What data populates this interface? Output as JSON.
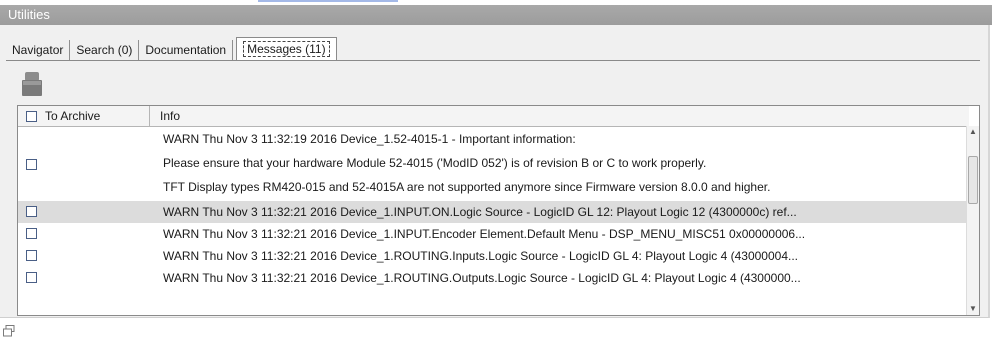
{
  "panel": {
    "title": "Utilities"
  },
  "tabs": [
    {
      "label": "Navigator"
    },
    {
      "label": "Search (0)"
    },
    {
      "label": "Documentation"
    },
    {
      "label": "Messages (11)"
    }
  ],
  "toolbar": {
    "archive_icon": "archive-icon"
  },
  "grid": {
    "columns": [
      "To Archive",
      "Info"
    ],
    "rows": [
      {
        "lines": [
          "WARN  Thu Nov  3 11:32:19 2016 Device_1.52-4015-1 - Important information:",
          "Please ensure that your hardware Module 52-4015 ('ModID 052') is of revision B or C to work properly.",
          "TFT Display types RM420-015 and 52-4015A are not supported anymore since Firmware version 8.0.0 and higher."
        ]
      },
      {
        "text": "WARN  Thu Nov  3 11:32:21 2016 Device_1.INPUT.ON.Logic Source - LogicID GL 12: Playout Logic 12 (4300000c) ref..."
      },
      {
        "text": "WARN  Thu Nov  3 11:32:21 2016 Device_1.INPUT.Encoder Element.Default Menu - DSP_MENU_MISC51 0x00000006..."
      },
      {
        "text": "WARN  Thu Nov  3 11:32:21 2016 Device_1.ROUTING.Inputs.Logic Source - LogicID GL 4: Playout Logic 4 (43000004..."
      },
      {
        "text": "WARN  Thu Nov  3 11:32:21 2016 Device_1.ROUTING.Outputs.Logic Source - LogicID GL 4: Playout Logic 4 (4300000..."
      }
    ]
  },
  "colors": {
    "header_bg": "#a3a3a3",
    "selected_row": "#dcdcdc",
    "checkbox_border": "#4a5f86"
  }
}
